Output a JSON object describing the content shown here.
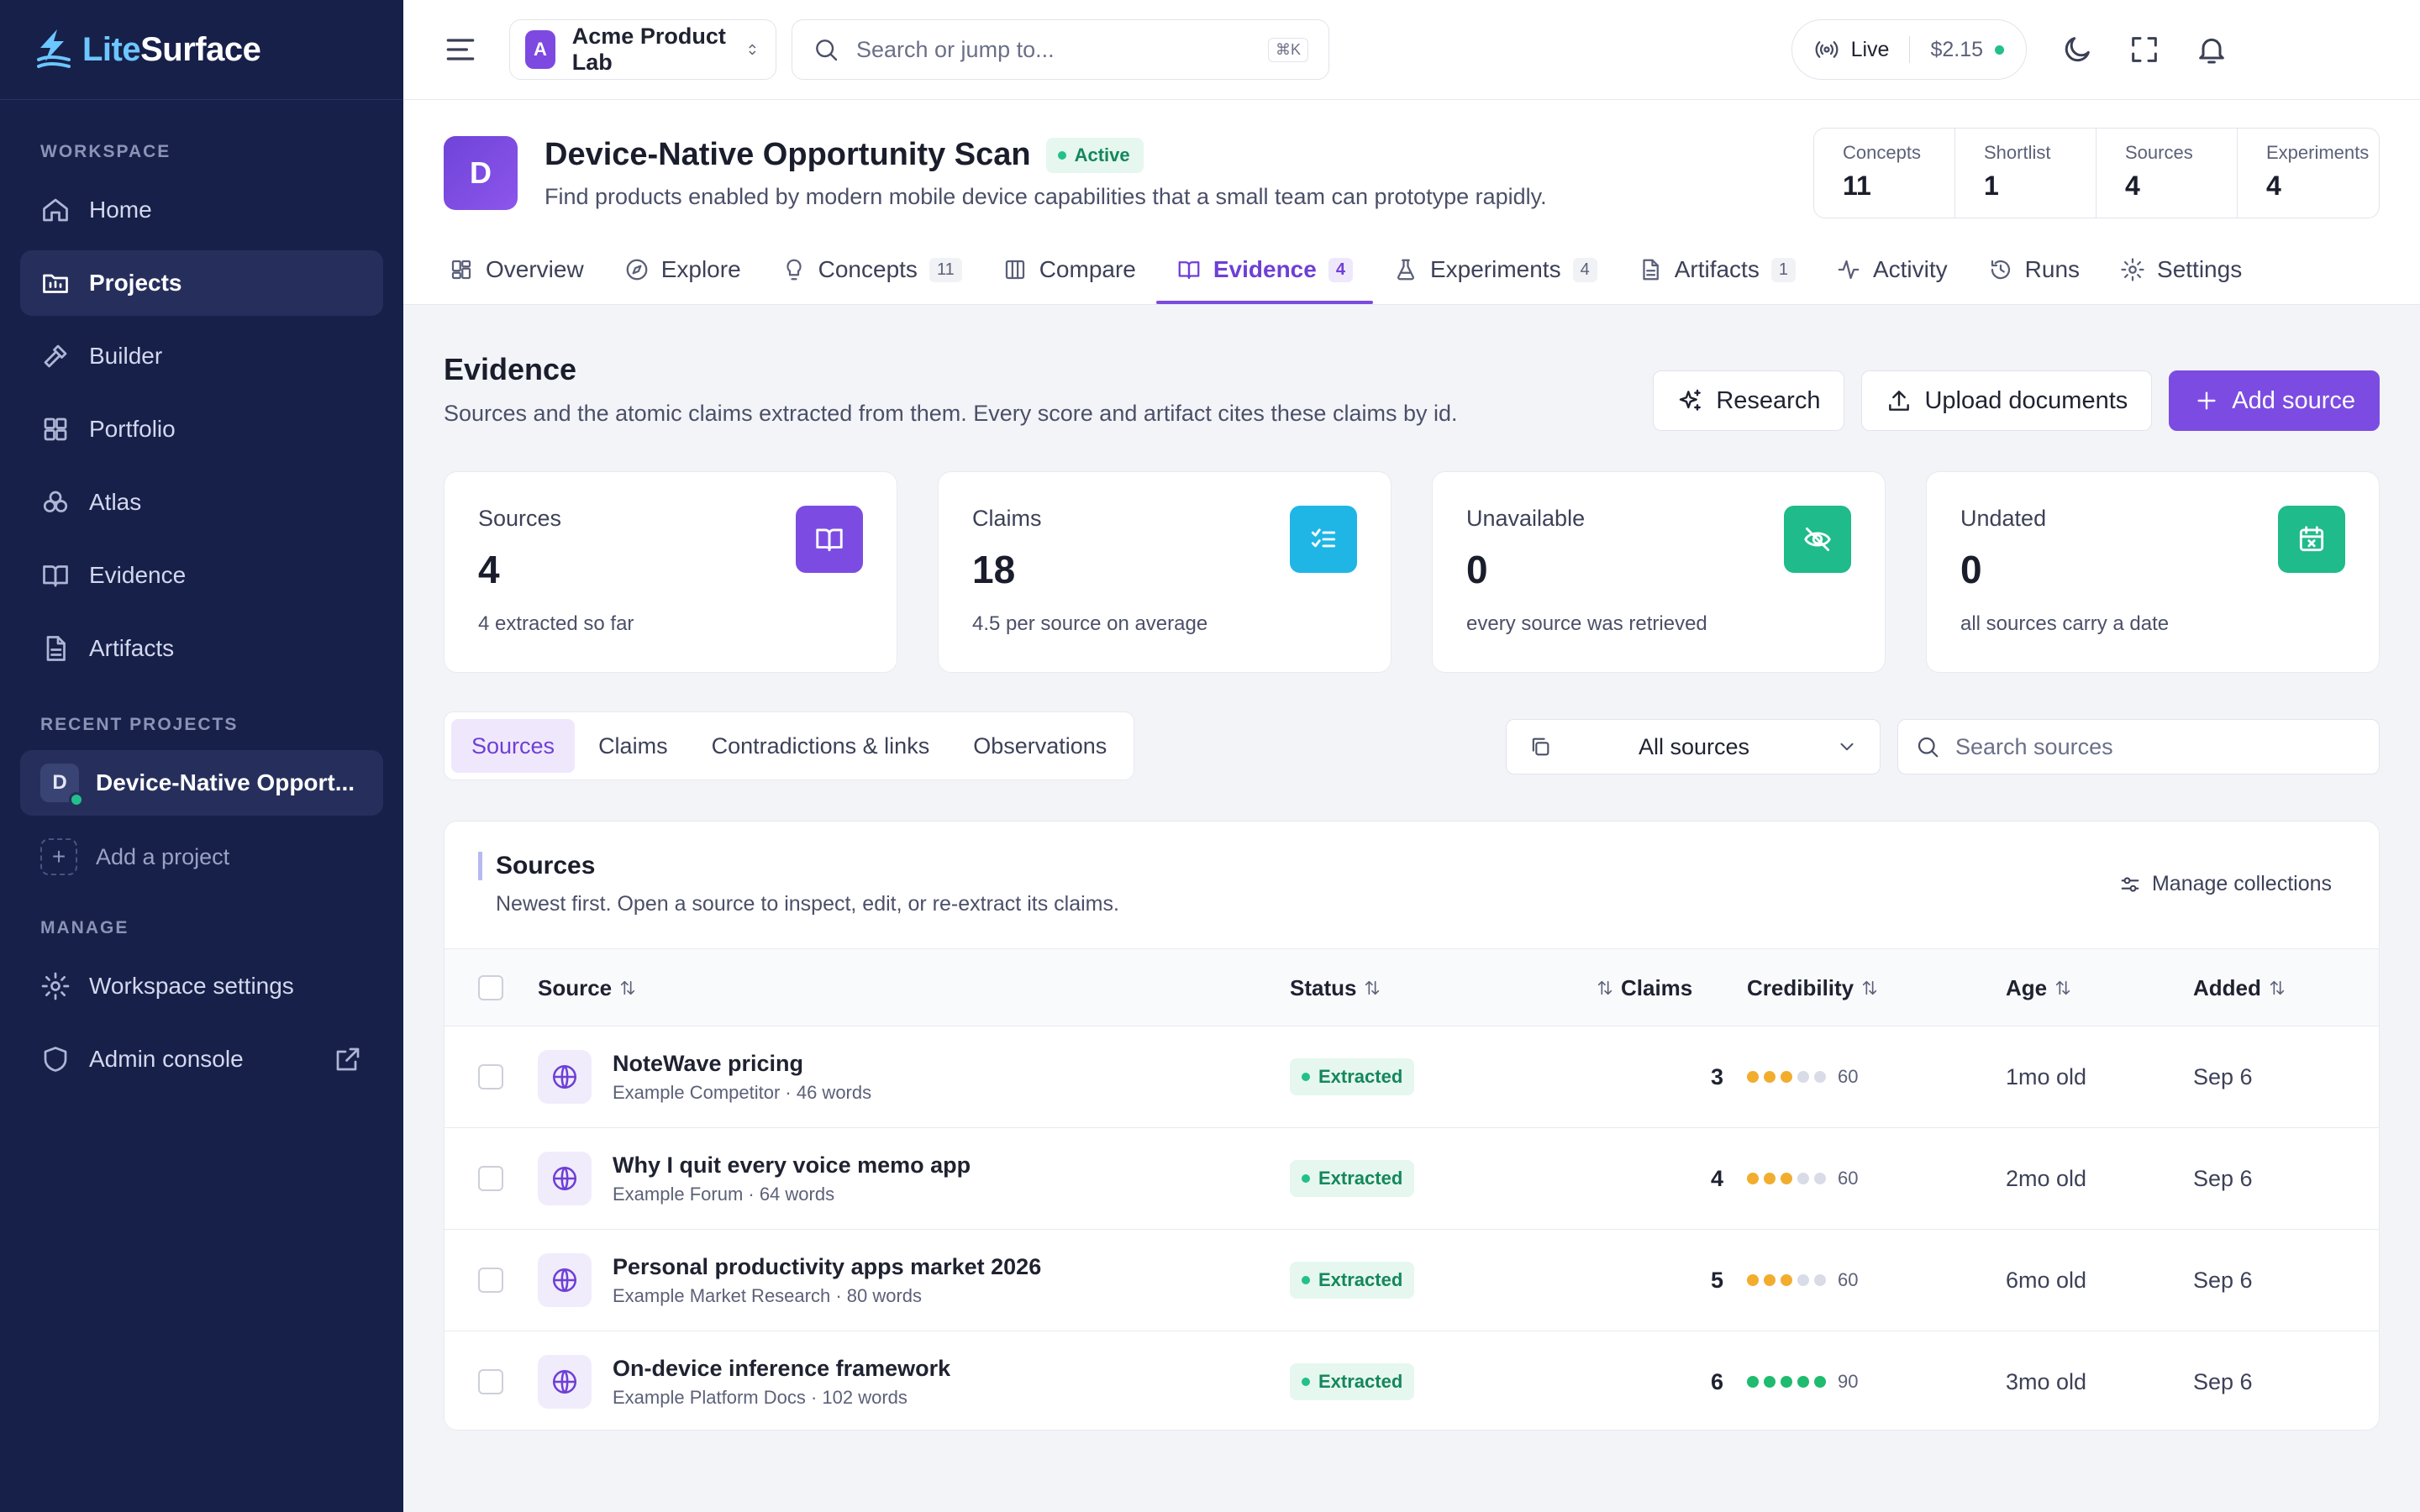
{
  "brand": {
    "name_part1": "Lite",
    "name_part2": "Surface"
  },
  "sidebar": {
    "workspace_label": "WORKSPACE",
    "items": [
      {
        "label": "Home",
        "icon": "home-icon",
        "active": false
      },
      {
        "label": "Projects",
        "icon": "projects-icon",
        "active": true
      },
      {
        "label": "Builder",
        "icon": "hammer-icon",
        "active": false
      },
      {
        "label": "Portfolio",
        "icon": "grid-icon",
        "active": false
      },
      {
        "label": "Atlas",
        "icon": "atlas-icon",
        "active": false
      },
      {
        "label": "Evidence",
        "icon": "book-icon",
        "active": false
      },
      {
        "label": "Artifacts",
        "icon": "document-icon",
        "active": false
      }
    ],
    "recent_label": "RECENT PROJECTS",
    "recent_project": {
      "initial": "D",
      "name": "Device-Native Opport..."
    },
    "add_project": "Add a project",
    "manage_label": "MANAGE",
    "manage_items": [
      {
        "label": "Workspace settings",
        "icon": "gear-icon"
      },
      {
        "label": "Admin console",
        "icon": "shield-icon"
      }
    ]
  },
  "topbar": {
    "workspace_initial": "A",
    "workspace_name": "Acme Product Lab",
    "search_placeholder": "Search or jump to...",
    "search_shortcut": "⌘K",
    "live_label": "Live",
    "cost": "$2.15"
  },
  "project": {
    "initial": "D",
    "title": "Device-Native Opportunity Scan",
    "status": "Active",
    "description": "Find products enabled by modern mobile device capabilities that a small team can prototype rapidly.",
    "stats": [
      {
        "label": "Concepts",
        "value": "11"
      },
      {
        "label": "Shortlist",
        "value": "1"
      },
      {
        "label": "Sources",
        "value": "4"
      },
      {
        "label": "Experiments",
        "value": "4"
      }
    ],
    "tabs": [
      {
        "label": "Overview",
        "count": "",
        "icon": "overview-icon",
        "active": false
      },
      {
        "label": "Explore",
        "count": "",
        "icon": "compass-icon",
        "active": false
      },
      {
        "label": "Concepts",
        "count": "11",
        "icon": "lightbulb-icon",
        "active": false
      },
      {
        "label": "Compare",
        "count": "",
        "icon": "columns-icon",
        "active": false
      },
      {
        "label": "Evidence",
        "count": "4",
        "icon": "book-icon",
        "active": true
      },
      {
        "label": "Experiments",
        "count": "4",
        "icon": "flask-icon",
        "active": false
      },
      {
        "label": "Artifacts",
        "count": "1",
        "icon": "document-icon",
        "active": false
      },
      {
        "label": "Activity",
        "count": "",
        "icon": "activity-icon",
        "active": false
      },
      {
        "label": "Runs",
        "count": "",
        "icon": "history-icon",
        "active": false
      },
      {
        "label": "Settings",
        "count": "",
        "icon": "gear-icon",
        "active": false
      }
    ]
  },
  "evidence": {
    "title": "Evidence",
    "subtitle": "Sources and the atomic claims extracted from them. Every score and artifact cites these claims by id.",
    "actions": {
      "research": "Research",
      "upload": "Upload documents",
      "add": "Add source"
    },
    "cards": [
      {
        "label": "Sources",
        "value": "4",
        "sub": "4 extracted so far",
        "color": "#7c4ce2",
        "icon": "book-icon"
      },
      {
        "label": "Claims",
        "value": "18",
        "sub": "4.5 per source on average",
        "color": "#1fb6e6",
        "icon": "checklist-icon"
      },
      {
        "label": "Unavailable",
        "value": "0",
        "sub": "every source was retrieved",
        "color": "#1fbb8a",
        "icon": "eye-off-icon"
      },
      {
        "label": "Undated",
        "value": "0",
        "sub": "all sources carry a date",
        "color": "#1fbb8a",
        "icon": "calendar-x-icon"
      }
    ],
    "subtabs": [
      {
        "label": "Sources",
        "active": true
      },
      {
        "label": "Claims",
        "active": false
      },
      {
        "label": "Contradictions & links",
        "active": false
      },
      {
        "label": "Observations",
        "active": false
      }
    ],
    "filter_value": "All sources",
    "search_placeholder": "Search sources",
    "panel": {
      "title": "Sources",
      "subtitle": "Newest first. Open a source to inspect, edit, or re-extract its claims.",
      "manage": "Manage collections"
    },
    "columns": {
      "source": "Source",
      "status": "Status",
      "claims": "Claims",
      "credibility": "Credibility",
      "age": "Age",
      "added": "Added"
    },
    "rows": [
      {
        "name": "NoteWave pricing",
        "meta": "Example Competitor · 46 words",
        "status": "Extracted",
        "claims": "3",
        "cred_dots": 3,
        "cred_color": "#f2ad2f",
        "cred_value": "60",
        "age": "1mo old",
        "added": "Sep 6"
      },
      {
        "name": "Why I quit every voice memo app",
        "meta": "Example Forum · 64 words",
        "status": "Extracted",
        "claims": "4",
        "cred_dots": 3,
        "cred_color": "#f2ad2f",
        "cred_value": "60",
        "age": "2mo old",
        "added": "Sep 6"
      },
      {
        "name": "Personal productivity apps market 2026",
        "meta": "Example Market Research · 80 words",
        "status": "Extracted",
        "claims": "5",
        "cred_dots": 3,
        "cred_color": "#f2ad2f",
        "cred_value": "60",
        "age": "6mo old",
        "added": "Sep 6"
      },
      {
        "name": "On-device inference framework",
        "meta": "Example Platform Docs · 102 words",
        "status": "Extracted",
        "claims": "6",
        "cred_dots": 5,
        "cred_color": "#1fbb6e",
        "cred_value": "90",
        "age": "3mo old",
        "added": "Sep 6"
      }
    ]
  }
}
